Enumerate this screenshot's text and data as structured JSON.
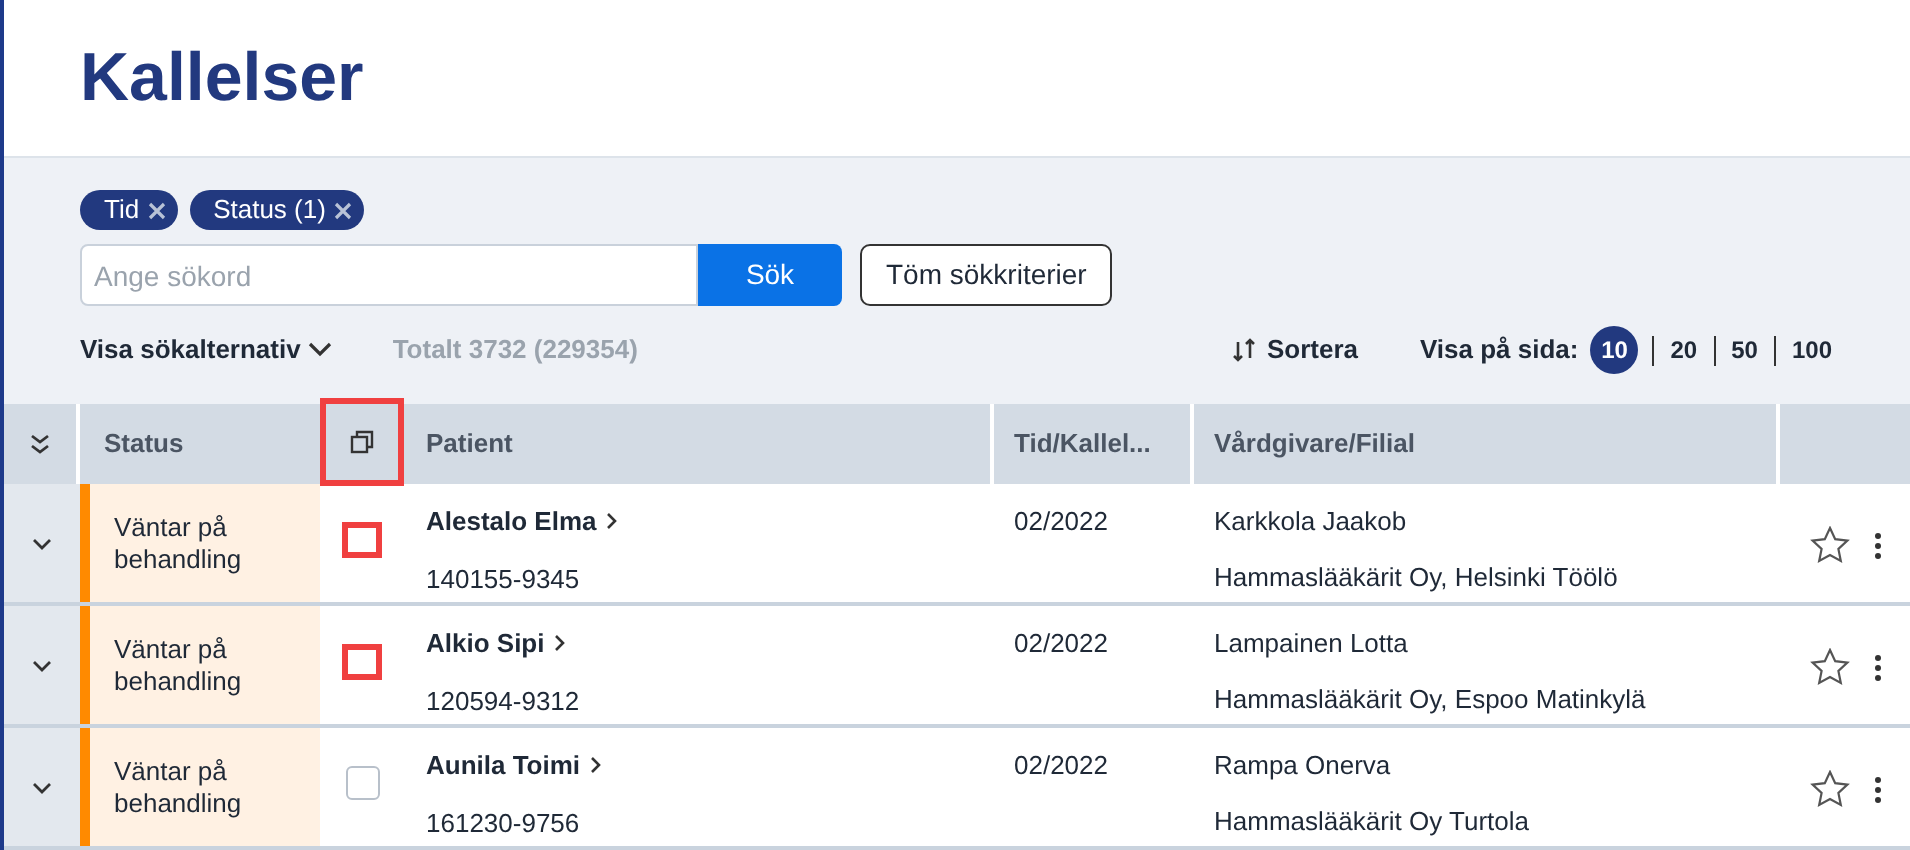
{
  "title": "Kallelser",
  "filters": [
    {
      "label": "Tid"
    },
    {
      "label": "Status (1)"
    }
  ],
  "search": {
    "placeholder": "Ange sökord",
    "button": "Sök",
    "clear": "Töm sökkriterier"
  },
  "options_toggle": "Visa sökalternativ",
  "total": "Totalt 3732 (229354)",
  "sort": "Sortera",
  "page_size": {
    "label": "Visa på sida:",
    "options": [
      {
        "label": "10",
        "selected": true
      },
      {
        "label": "20",
        "selected": false
      },
      {
        "label": "50",
        "selected": false
      },
      {
        "label": "100",
        "selected": false
      }
    ]
  },
  "table": {
    "columns": [
      "Status",
      "Patient",
      "Tid/Kallel...",
      "Vårdgivare/Filial"
    ],
    "copy_highlighted": true,
    "rows": [
      {
        "status": "Väntar på behandling",
        "color": "#ff8a00",
        "checked": false,
        "highlighted": true,
        "patient": "Alestalo Elma",
        "id": "140155-9345",
        "time": "02/2022",
        "provider": "Karkkola Jaakob",
        "clinic": "Hammaslääkärit Oy, Helsinki Töölö",
        "starred": false
      },
      {
        "status": "Väntar på behandling",
        "color": "#ff8a00",
        "checked": false,
        "highlighted": true,
        "patient": "Alkio Sipi",
        "id": "120594-9312",
        "time": "02/2022",
        "provider": "Lampainen Lotta",
        "clinic": "Hammaslääkärit Oy, Espoo Matinkylä",
        "starred": false
      },
      {
        "status": "Väntar på behandling",
        "color": "#ff8a00",
        "checked": false,
        "highlighted": false,
        "patient": "Aunila Toimi",
        "id": "161230-9756",
        "time": "02/2022",
        "provider": "Rampa Onerva",
        "clinic": "Hammaslääkärit Oy Turtola",
        "starred": false
      }
    ]
  }
}
